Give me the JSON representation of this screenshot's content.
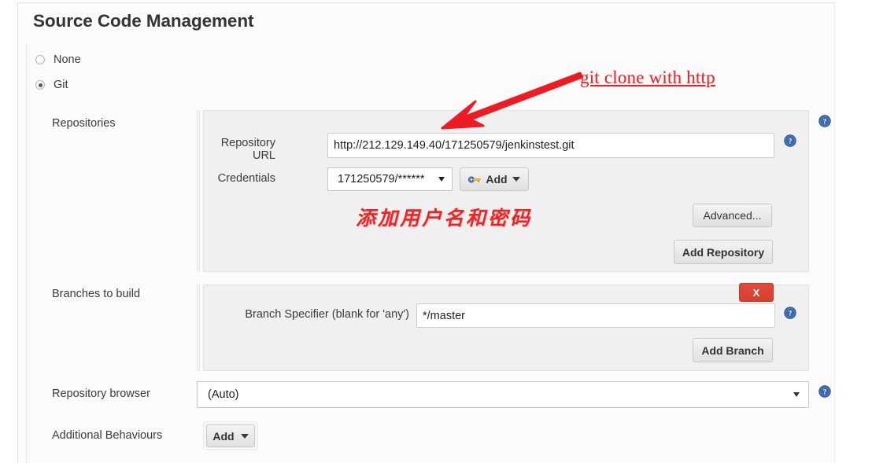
{
  "page": {
    "section_title": "Source Code Management"
  },
  "scm_options": [
    {
      "label": "None",
      "selected": false
    },
    {
      "label": "Git",
      "selected": true
    }
  ],
  "repositories": {
    "row_label": "Repositories",
    "repository_url": {
      "label": "Repository URL",
      "value": "http://212.129.149.40/171250579/jenkinstest.git",
      "placeholder": ""
    },
    "credentials": {
      "label": "Credentials",
      "selected": "171250579/******",
      "add_button": "Add",
      "add_icon": "key-icon",
      "caret_icon": "chevron-down-icon"
    },
    "advanced_button": "Advanced...",
    "add_repository_button": "Add Repository"
  },
  "branches": {
    "row_label": "Branches to build",
    "branch_specifier": {
      "label": "Branch Specifier (blank for 'any')",
      "value": "*/master"
    },
    "delete_button": "X",
    "add_branch_button": "Add Branch"
  },
  "repository_browser": {
    "row_label": "Repository browser",
    "selected": "(Auto)",
    "caret_icon": "chevron-down-icon"
  },
  "additional_behaviours": {
    "row_label": "Additional Behaviours",
    "add_button": "Add",
    "caret_icon": "chevron-down-icon"
  },
  "help_icons": {
    "repositories": "help-icon",
    "repository_url": "help-icon",
    "branch_specifier": "help-icon",
    "repository_browser": "help-icon"
  },
  "annotations": {
    "arrow": "red-arrow-annotation",
    "english_note": "git clone with http",
    "chinese_note": "添加用户名和密码"
  },
  "colors": {
    "annotation_red": "#e8262a",
    "delete_button_red": "#d6402f",
    "help_blue": "#3b68ad",
    "panel_grey": "#f0f0f0"
  }
}
